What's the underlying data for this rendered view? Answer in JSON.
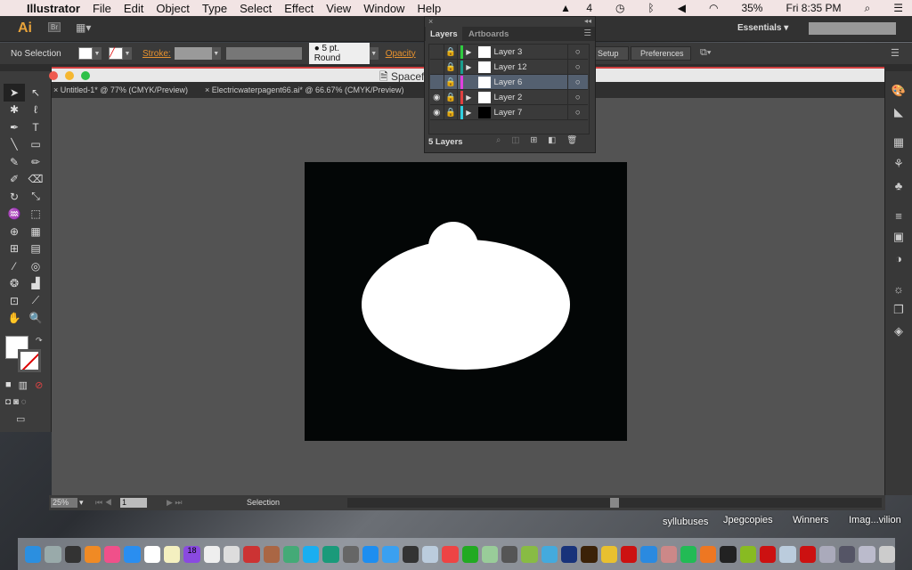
{
  "menubar": {
    "apple": "",
    "app": "Illustrator",
    "items": [
      "File",
      "Edit",
      "Object",
      "Type",
      "Select",
      "Effect",
      "View",
      "Window",
      "Help"
    ],
    "adobe_count": "4",
    "battery": "35%",
    "clock": "Fri 8:35 PM"
  },
  "appbar": {
    "logo": "Ai",
    "bridge": "Br",
    "workspace": "Essentials",
    "search_placeholder": ""
  },
  "control": {
    "selection": "No Selection",
    "stroke_label": "Stroke:",
    "brush": "5 pt. Round",
    "opacity_label": "Opacity",
    "setup": "Setup",
    "preferences": "Preferences",
    "fill_color": "#ffffff"
  },
  "document": {
    "window_title": "Spacef",
    "tabs": [
      "Untitled-1* @ 77% (CMYK/Preview)",
      "Electricwaterpagent66.ai* @ 66.67% (CMYK/Preview)"
    ]
  },
  "tools": [
    "selection",
    "direct-selection",
    "magic-wand",
    "lasso",
    "pen",
    "type",
    "line",
    "rectangle",
    "paintbrush",
    "pencil",
    "blob-brush",
    "eraser",
    "rotate",
    "scale",
    "warp",
    "free-transform",
    "shape-builder",
    "perspective-grid",
    "mesh",
    "gradient",
    "eyedropper",
    "blend",
    "symbol-sprayer",
    "column-graph",
    "artboard",
    "slice",
    "hand",
    "zoom"
  ],
  "layers_panel": {
    "tabs": [
      "Layers",
      "Artboards"
    ],
    "layers": [
      {
        "name": "Layer 3",
        "color": "#2ecc40",
        "visible": false,
        "expand": true,
        "selected": false
      },
      {
        "name": "Layer 12",
        "color": "#1a9e8e",
        "visible": false,
        "expand": true,
        "selected": false
      },
      {
        "name": "Layer 6",
        "color": "#e040e0",
        "visible": false,
        "expand": false,
        "selected": true
      },
      {
        "name": "Layer 2",
        "color": "#e04040",
        "visible": true,
        "expand": true,
        "selected": false
      },
      {
        "name": "Layer 7",
        "color": "#30d0e0",
        "visible": true,
        "expand": true,
        "selected": false
      }
    ],
    "count": "5 Layers"
  },
  "status": {
    "zoom": "25%",
    "artboard": "1",
    "tool": "Selection"
  },
  "desktop": {
    "folders": [
      "syllubuses",
      "Jpegcopies",
      "Winners",
      "Imag...vilion"
    ]
  },
  "dock": {
    "calendar_day": "18"
  }
}
